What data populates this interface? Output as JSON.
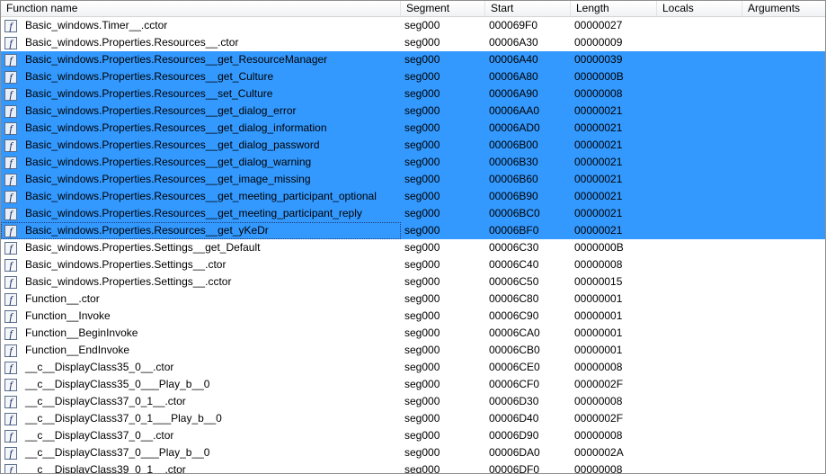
{
  "columns": {
    "name": "Function name",
    "segment": "Segment",
    "start": "Start",
    "length": "Length",
    "locals": "Locals",
    "arguments": "Arguments"
  },
  "icon_name": "function-icon",
  "colors": {
    "selection": "#3399ff"
  },
  "rows": [
    {
      "name": "Basic_windows.Timer__.cctor",
      "segment": "seg000",
      "start": "000069F0",
      "length": "00000027",
      "selected": false
    },
    {
      "name": "Basic_windows.Properties.Resources__.ctor",
      "segment": "seg000",
      "start": "00006A30",
      "length": "00000009",
      "selected": false
    },
    {
      "name": "Basic_windows.Properties.Resources__get_ResourceManager",
      "segment": "seg000",
      "start": "00006A40",
      "length": "00000039",
      "selected": true
    },
    {
      "name": "Basic_windows.Properties.Resources__get_Culture",
      "segment": "seg000",
      "start": "00006A80",
      "length": "0000000B",
      "selected": true
    },
    {
      "name": "Basic_windows.Properties.Resources__set_Culture",
      "segment": "seg000",
      "start": "00006A90",
      "length": "00000008",
      "selected": true
    },
    {
      "name": "Basic_windows.Properties.Resources__get_dialog_error",
      "segment": "seg000",
      "start": "00006AA0",
      "length": "00000021",
      "selected": true
    },
    {
      "name": "Basic_windows.Properties.Resources__get_dialog_information",
      "segment": "seg000",
      "start": "00006AD0",
      "length": "00000021",
      "selected": true
    },
    {
      "name": "Basic_windows.Properties.Resources__get_dialog_password",
      "segment": "seg000",
      "start": "00006B00",
      "length": "00000021",
      "selected": true
    },
    {
      "name": "Basic_windows.Properties.Resources__get_dialog_warning",
      "segment": "seg000",
      "start": "00006B30",
      "length": "00000021",
      "selected": true
    },
    {
      "name": "Basic_windows.Properties.Resources__get_image_missing",
      "segment": "seg000",
      "start": "00006B60",
      "length": "00000021",
      "selected": true
    },
    {
      "name": "Basic_windows.Properties.Resources__get_meeting_participant_optional",
      "segment": "seg000",
      "start": "00006B90",
      "length": "00000021",
      "selected": true
    },
    {
      "name": "Basic_windows.Properties.Resources__get_meeting_participant_reply",
      "segment": "seg000",
      "start": "00006BC0",
      "length": "00000021",
      "selected": true
    },
    {
      "name": "Basic_windows.Properties.Resources__get_yKeDr",
      "segment": "seg000",
      "start": "00006BF0",
      "length": "00000021",
      "selected": true,
      "focused": true
    },
    {
      "name": "Basic_windows.Properties.Settings__get_Default",
      "segment": "seg000",
      "start": "00006C30",
      "length": "0000000B",
      "selected": false
    },
    {
      "name": "Basic_windows.Properties.Settings__.ctor",
      "segment": "seg000",
      "start": "00006C40",
      "length": "00000008",
      "selected": false
    },
    {
      "name": "Basic_windows.Properties.Settings__.cctor",
      "segment": "seg000",
      "start": "00006C50",
      "length": "00000015",
      "selected": false
    },
    {
      "name": "Function__.ctor",
      "segment": "seg000",
      "start": "00006C80",
      "length": "00000001",
      "selected": false
    },
    {
      "name": "Function__Invoke",
      "segment": "seg000",
      "start": "00006C90",
      "length": "00000001",
      "selected": false
    },
    {
      "name": "Function__BeginInvoke",
      "segment": "seg000",
      "start": "00006CA0",
      "length": "00000001",
      "selected": false
    },
    {
      "name": "Function__EndInvoke",
      "segment": "seg000",
      "start": "00006CB0",
      "length": "00000001",
      "selected": false
    },
    {
      "name": "__c__DisplayClass35_0__.ctor",
      "segment": "seg000",
      "start": "00006CE0",
      "length": "00000008",
      "selected": false
    },
    {
      "name": "__c__DisplayClass35_0___Play_b__0",
      "segment": "seg000",
      "start": "00006CF0",
      "length": "0000002F",
      "selected": false
    },
    {
      "name": "__c__DisplayClass37_0_1__.ctor",
      "segment": "seg000",
      "start": "00006D30",
      "length": "00000008",
      "selected": false
    },
    {
      "name": "__c__DisplayClass37_0_1___Play_b__0",
      "segment": "seg000",
      "start": "00006D40",
      "length": "0000002F",
      "selected": false
    },
    {
      "name": "__c__DisplayClass37_0__.ctor",
      "segment": "seg000",
      "start": "00006D90",
      "length": "00000008",
      "selected": false
    },
    {
      "name": "__c__DisplayClass37_0___Play_b__0",
      "segment": "seg000",
      "start": "00006DA0",
      "length": "0000002A",
      "selected": false
    },
    {
      "name": "__c__DisplayClass39_0_1__.ctor",
      "segment": "seg000",
      "start": "00006DF0",
      "length": "00000008",
      "selected": false
    }
  ]
}
